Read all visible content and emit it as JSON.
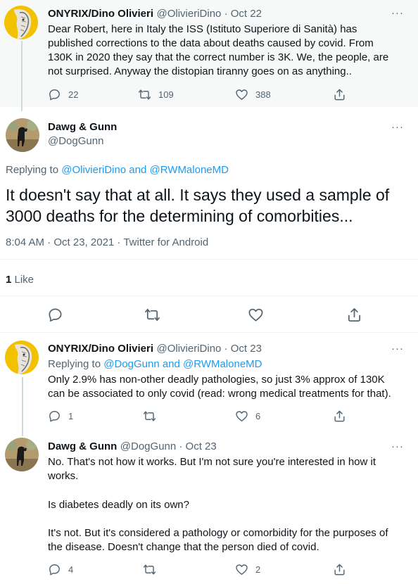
{
  "colors": {
    "link": "#1d9bf0",
    "muted": "#536471",
    "text": "#0f1419",
    "line": "#cfd9de"
  },
  "tweet1": {
    "name": "ONYRIX/Dino Olivieri",
    "handle_date": "@OlivieriDino · Oct 22",
    "text": "Dear Robert, here in Italy the ISS (Istituto Superiore di Sanità) has published corrections to the data about deaths caused by covid. From 130K in 2020 they say that the correct number is 3K. We, the people, are not surprised. Anyway the distopian tiranny goes on as anything..",
    "replies": "22",
    "retweets": "109",
    "likes": "388"
  },
  "main": {
    "name": "Dawg & Gunn",
    "handle": "@DogGunn",
    "replying_prefix": "Replying to ",
    "replying_to": "@OlivieriDino and @RWMaloneMD",
    "text": "It doesn't say that at all. It says they used a sample of 3000 deaths for the determining of comorbities...",
    "timestamp": "8:04 AM · Oct 23, 2021 · Twitter for Android",
    "like_count": "1",
    "like_label": " Like"
  },
  "tweet3": {
    "name": "ONYRIX/Dino Olivieri",
    "handle_date": "@OlivieriDino · Oct 23",
    "replying_prefix": "Replying to ",
    "replying_to": "@DogGunn and @RWMaloneMD",
    "text": "Only 2.9% has non-other deadly pathologies, so just 3% approx of 130K can be associated to only covid (read: wrong medical treatments for that).",
    "replies": "1",
    "retweets": "",
    "likes": "6"
  },
  "tweet4": {
    "name": "Dawg & Gunn",
    "handle_date": "@DogGunn · Oct 23",
    "text_p1": "No. That's not how it works. But I'm not sure you're interested in how it works.",
    "text_p2": "Is diabetes deadly on its own?",
    "text_p3": "It's not. But it's considered a pathology or comorbidity for the purposes of the disease. Doesn't change that the person died of covid.",
    "replies": "4",
    "retweets": "",
    "likes": "2"
  },
  "more_icon": "···",
  "icons": [
    "reply-icon",
    "retweet-icon",
    "like-icon",
    "share-icon",
    "more-icon"
  ]
}
